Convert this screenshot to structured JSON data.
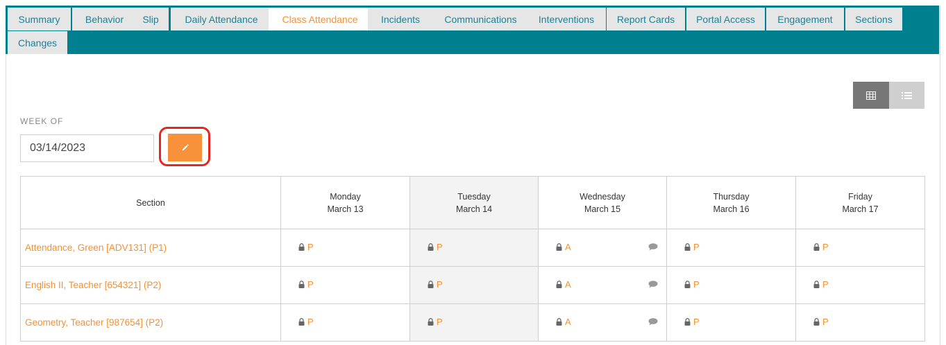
{
  "tabs": [
    {
      "label": "Summary"
    },
    {
      "label": "Behavior"
    },
    {
      "label": "Slip"
    },
    {
      "label": "Daily Attendance"
    },
    {
      "label": "Class Attendance",
      "active": true
    },
    {
      "label": "Incidents"
    },
    {
      "label": "Communications"
    },
    {
      "label": "Interventions"
    },
    {
      "label": "Report Cards"
    },
    {
      "label": "Portal Access"
    },
    {
      "label": "Engagement"
    },
    {
      "label": "Sections"
    },
    {
      "label": "Changes"
    }
  ],
  "colors": {
    "tab_bar": "#00808f",
    "accent": "#f59032",
    "link": "#1e7f95",
    "highlight": "#e8251f"
  },
  "view_toggle": {
    "active": "grid-view",
    "icons": [
      "grid-icon",
      "list-icon"
    ]
  },
  "week": {
    "label": "WEEK OF",
    "date": "03/14/2023",
    "edit_icon": "pencil-icon"
  },
  "table": {
    "section_header": "Section",
    "days": [
      {
        "name": "Monday",
        "date": "March 13"
      },
      {
        "name": "Tuesday",
        "date": "March 14"
      },
      {
        "name": "Wednesday",
        "date": "March 15"
      },
      {
        "name": "Thursday",
        "date": "March 16"
      },
      {
        "name": "Friday",
        "date": "March 17"
      }
    ],
    "rows": [
      {
        "section": "Attendance, Green [ADV131] (P1)",
        "marks": [
          "P",
          "P",
          "A",
          "P",
          "P"
        ]
      },
      {
        "section": "English II, Teacher [654321] (P2)",
        "marks": [
          "P",
          "P",
          "A",
          "P",
          "P"
        ]
      },
      {
        "section": "Geometry, Teacher [987654] (P2)",
        "marks": [
          "P",
          "P",
          "A",
          "P",
          "P"
        ]
      }
    ],
    "lock_icon": "lock-icon",
    "comment_icon": "comment-icon"
  }
}
